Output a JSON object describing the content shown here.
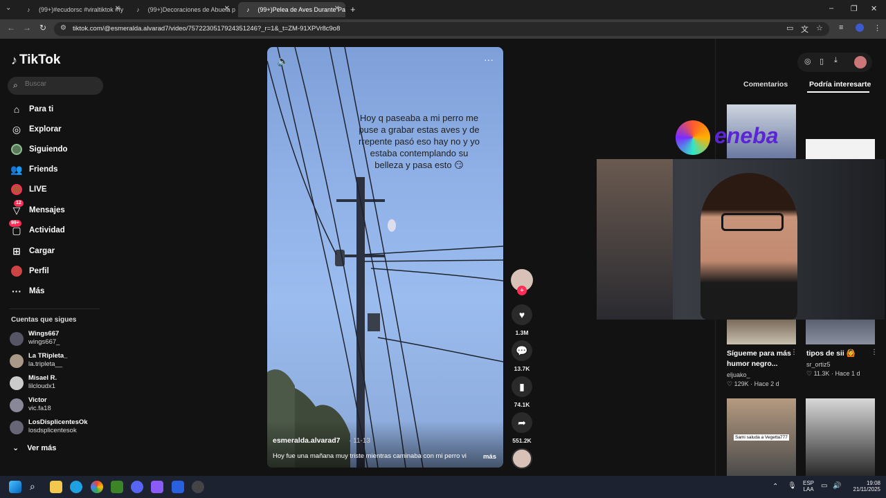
{
  "tabs": [
    {
      "title": "(99+)#ecudorsc #viraltiktok #fy",
      "active": false
    },
    {
      "title": "(99+)Decoraciones de Abuela p",
      "active": false
    },
    {
      "title": "(99+)Pelea de Aves Durante Pa",
      "active": true
    }
  ],
  "address": {
    "url": "tiktok.com/@esmeralda.alvarad7/video/7572230517924351246?_r=1&_t=ZM-91XPVr8c9o8"
  },
  "sidebar": {
    "logo": "TikTok",
    "search_placeholder": "Buscar",
    "nav": [
      {
        "label": "Para ti",
        "icon": "home-icon"
      },
      {
        "label": "Explorar",
        "icon": "compass-icon"
      },
      {
        "label": "Siguiendo",
        "icon": "following-icon"
      },
      {
        "label": "Friends",
        "icon": "friends-icon"
      },
      {
        "label": "LIVE",
        "icon": "live-icon"
      },
      {
        "label": "Mensajes",
        "icon": "messages-icon",
        "badge": "12"
      },
      {
        "label": "Actividad",
        "icon": "activity-icon",
        "badge": "99+"
      },
      {
        "label": "Cargar",
        "icon": "upload-icon"
      },
      {
        "label": "Perfil",
        "icon": "profile-icon"
      },
      {
        "label": "Más",
        "icon": "more-icon"
      }
    ],
    "following_header": "Cuentas que sigues",
    "following": [
      {
        "name": "Wings667",
        "handle": "wings667_"
      },
      {
        "name": "La TRipleta_",
        "handle": "la.tripleta__"
      },
      {
        "name": "Misael R.",
        "handle": "lilcloudx1"
      },
      {
        "name": "Victor",
        "handle": "vic.fa18"
      },
      {
        "name": "LosDisplicentesOk",
        "handle": "losdsplicentesok"
      }
    ],
    "see_more": "Ver más"
  },
  "video": {
    "overlay_text": "Hoy q paseaba a mi perro me puse a grabar estas aves y de rrepente pasó eso hay no y yo estaba contemplando su belleza y pasa esto 😏",
    "username": "esmeralda.alvarad7",
    "date": "· 11-13",
    "description": "Hoy fue una mañana muy triste mientras caminaba con mi perro vi",
    "more": "más"
  },
  "actions": {
    "likes": "1.3M",
    "comments": "13.7K",
    "saves": "74.1K",
    "shares": "551.2K"
  },
  "right_panel": {
    "tabs": [
      "Comentarios",
      "Podría interesarte"
    ],
    "active_tab": "Podría interesarte",
    "cards": [
      {
        "title": "Sígueme para más humor negro...",
        "user": "eljuako_",
        "likes": "129K",
        "age": "Hace 2 d"
      },
      {
        "title": "tipos de sii 🙆",
        "user": "sr_ortiz5",
        "likes": "11.3K",
        "age": "Hace 1 d"
      }
    ],
    "thumb_caption": "Sami saluda a Vegetta777"
  },
  "overlay": {
    "brand": "eneba"
  },
  "taskbar": {
    "lang": "ESP",
    "region": "LAA",
    "time": "19:08",
    "date": "21/11/2025"
  }
}
